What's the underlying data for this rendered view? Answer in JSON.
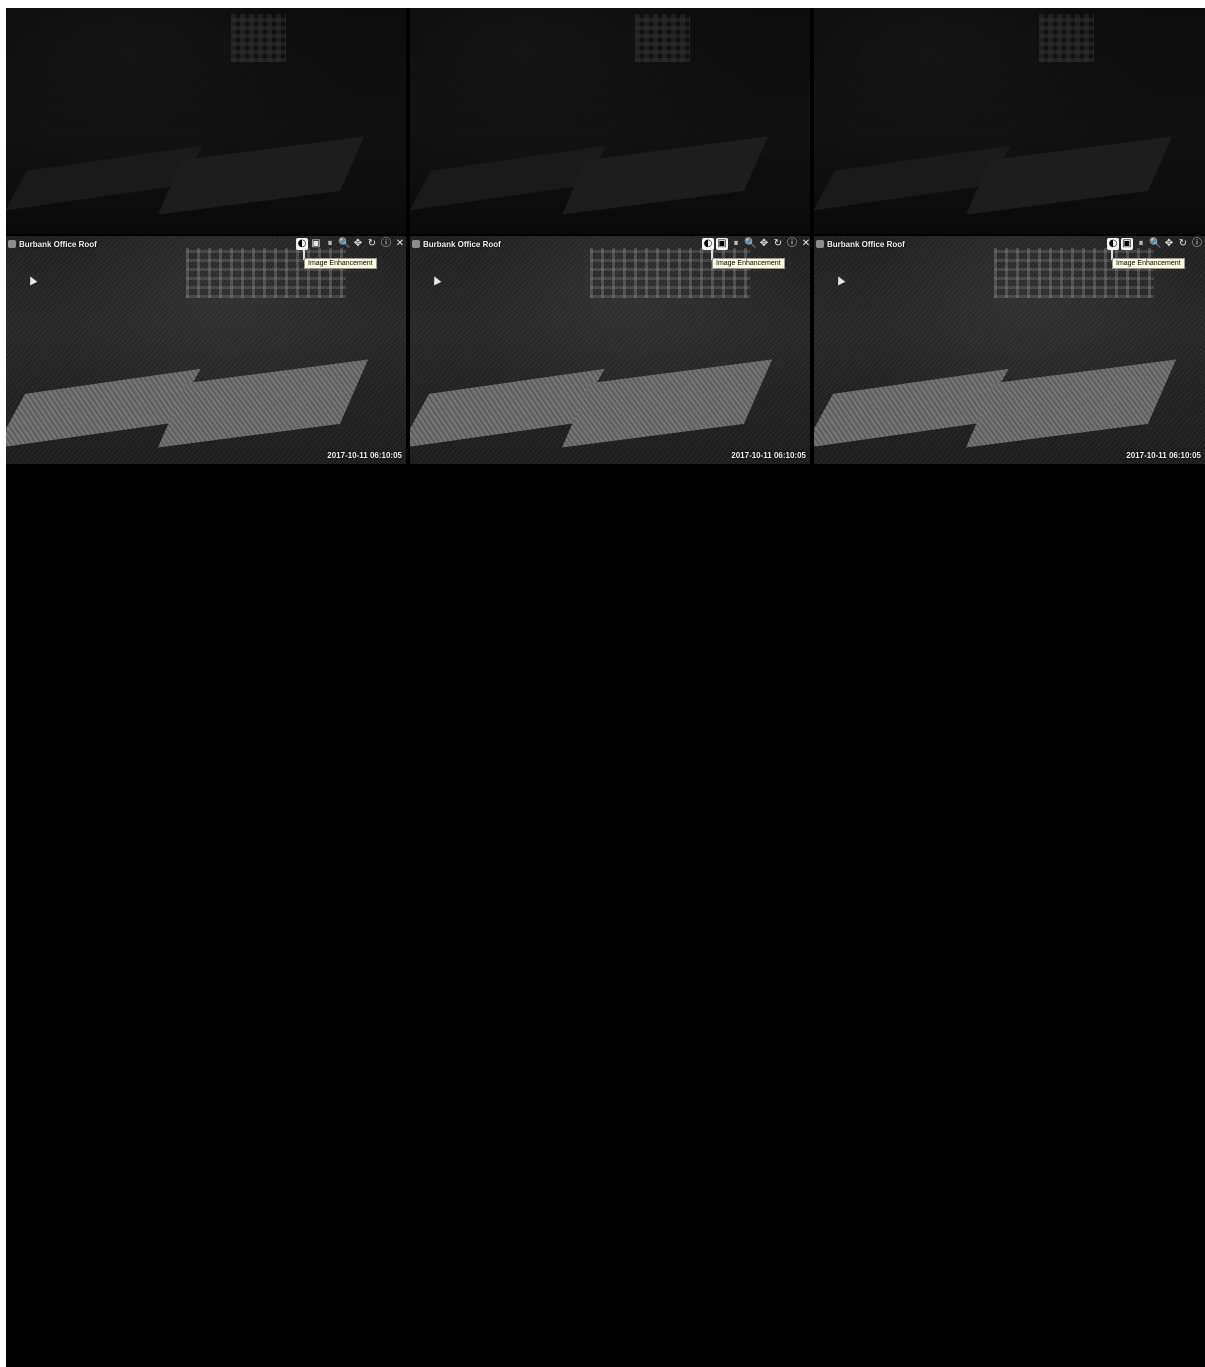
{
  "tiles": [
    {
      "title": "Burbank Office Roof",
      "timestamp": "2017-10-11 06:10:05",
      "tooltip": "Image Enhancement",
      "toolbar": [
        "brightness-icon",
        "image-enhancement-icon",
        "pause-icon",
        "zoom-icon",
        "ptz-icon",
        "rotate-icon",
        "info-icon",
        "close-icon"
      ]
    },
    {
      "title": "Burbank Office Roof",
      "timestamp": "2017-10-11 06:10:05",
      "tooltip": "Image Enhancement",
      "toolbar": [
        "brightness-icon",
        "image-enhancement-icon",
        "pause-icon",
        "zoom-icon",
        "ptz-icon",
        "rotate-icon",
        "info-icon",
        "close-icon"
      ]
    },
    {
      "title": "Burbank Office Roof",
      "timestamp": "2017-10-11 06:10:05",
      "tooltip": "Image Enhancement",
      "toolbar": [
        "brightness-icon",
        "image-enhancement-icon",
        "pause-icon",
        "zoom-icon",
        "ptz-icon",
        "rotate-icon",
        "info-icon"
      ]
    }
  ],
  "icons": {
    "brightness-icon": "◐",
    "image-enhancement-icon": "▣",
    "pause-icon": "⏸",
    "zoom-icon": "🔍",
    "ptz-icon": "✥",
    "rotate-icon": "↻",
    "info-icon": "ⓘ",
    "close-icon": "✕"
  }
}
